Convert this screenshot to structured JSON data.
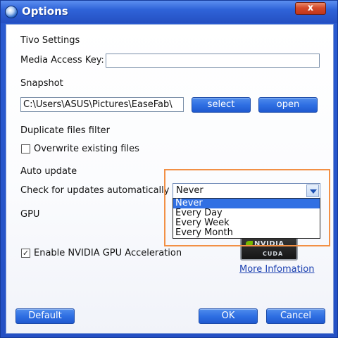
{
  "window": {
    "title": "Options",
    "close_label": "x"
  },
  "tivo": {
    "heading": "Tivo Settings",
    "media_key_label": "Media Access Key:",
    "media_key_value": ""
  },
  "snapshot": {
    "heading": "Snapshot",
    "path_value": "C:\\Users\\ASUS\\Pictures\\EaseFab\\",
    "select_label": "select",
    "open_label": "open"
  },
  "duplicate": {
    "heading": "Duplicate files filter",
    "overwrite_label": "Overwrite existing files",
    "overwrite_checked": false
  },
  "auto_update": {
    "heading": "Auto update",
    "check_label": "Check for updates automatically",
    "selected": "Never",
    "options": [
      "Never",
      "Every Day",
      "Every Week",
      "Every Month"
    ]
  },
  "gpu": {
    "heading": "GPU",
    "enable_label": "Enable NVIDIA GPU Acceleration",
    "enable_checked": true,
    "logo_brand": "NVIDIA",
    "logo_sub": "CUDA",
    "more_info_label": "More Infomation"
  },
  "footer": {
    "default_label": "Default",
    "ok_label": "OK",
    "cancel_label": "Cancel"
  },
  "colors": {
    "title_bar": "#2f63d8",
    "button_blue": "#2f6fe3",
    "highlight_orange": "#f29045",
    "selected_item": "#3170e3"
  },
  "icons": {
    "app": "app-icon",
    "close": "close-icon",
    "dropdown": "chevron-down-icon",
    "checkmark": "checkmark-icon",
    "nvidia": "nvidia-cuda-logo"
  }
}
